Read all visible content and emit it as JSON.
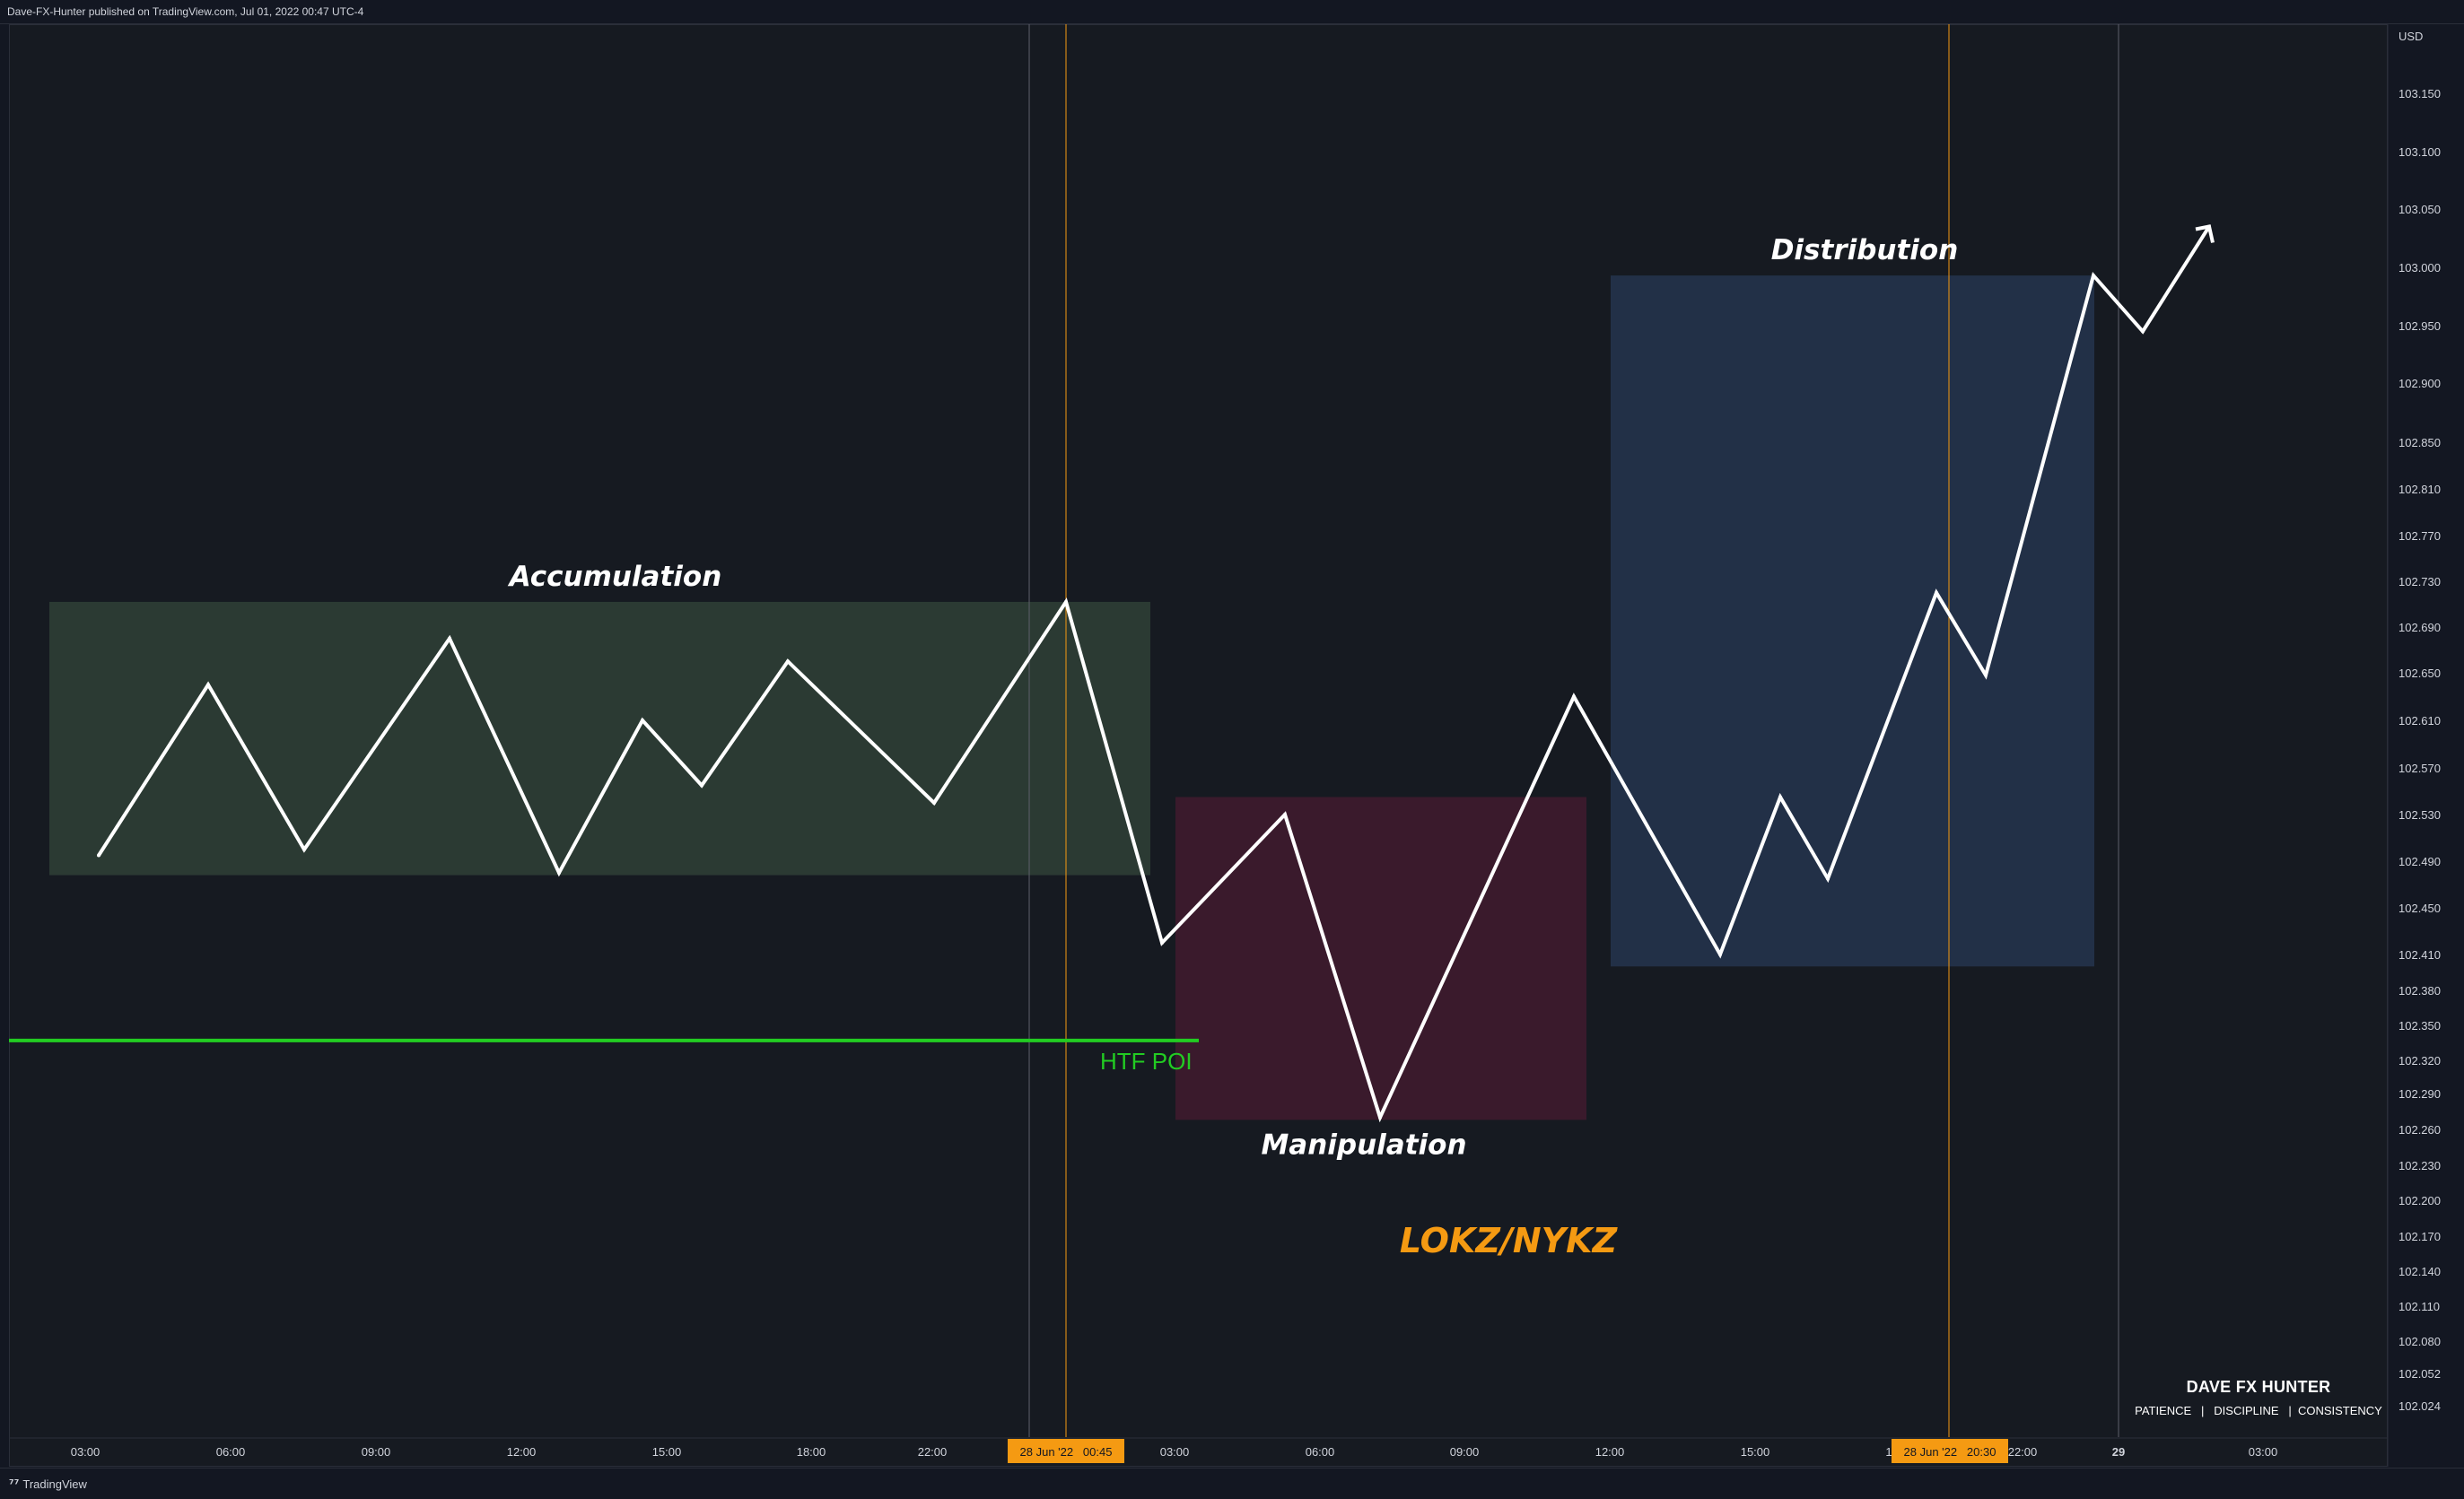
{
  "header": {
    "publisher": "Dave-FX-Hunter published on TradingView.com, Jul 01, 2022 00:47 UTC-4"
  },
  "footer": {
    "logo_text": "TradingView"
  },
  "branding": {
    "name": "DAVE FX HUNTER",
    "tagline": "PATIENCE   |   DISCIPLINE   |  CONSISTENCY"
  },
  "colors": {
    "background": "#161a21",
    "accumulation_zone": "#2b3a33",
    "manipulation_zone": "#3a1a2c",
    "distribution_zone": "#223047",
    "price_line": "#ffffff",
    "poi_line": "#22cc22",
    "session_label": "#f59a12",
    "grid_line": "#5d606b",
    "session_line": "#f59a12"
  },
  "chart_data": {
    "type": "line",
    "currency_label": "USD",
    "y_tick_labels": [
      "103.150",
      "103.100",
      "103.050",
      "103.000",
      "102.950",
      "102.900",
      "102.850",
      "102.810",
      "102.770",
      "102.730",
      "102.690",
      "102.650",
      "102.610",
      "102.570",
      "102.530",
      "102.490",
      "102.450",
      "102.410",
      "102.380",
      "102.350",
      "102.320",
      "102.290",
      "102.260",
      "102.230",
      "102.200",
      "102.170",
      "102.140",
      "102.110",
      "102.080",
      "102.052",
      "102.024"
    ],
    "x_tick_labels": [
      "03:00",
      "06:00",
      "09:00",
      "12:00",
      "15:00",
      "18:00",
      "22:00",
      "03:00",
      "06:00",
      "09:00",
      "12:00",
      "15:00",
      "1",
      "22:00",
      "29",
      "03:00"
    ],
    "x_time_badges": [
      "28 Jun '22   00:45",
      "28 Jun '22   20:30"
    ],
    "series": [
      {
        "values": [
          102.495,
          102.64,
          102.5,
          102.68,
          102.48,
          102.61,
          102.555,
          102.66,
          102.54,
          102.712,
          102.42,
          102.53,
          102.27,
          102.63,
          102.41,
          102.545,
          102.475,
          102.72,
          102.648,
          102.993,
          102.945,
          103.035
        ]
      }
    ],
    "zones": [
      {
        "label": "Accumulation",
        "y_range": [
          102.478,
          102.712
        ]
      },
      {
        "label": "Manipulation",
        "y_range": [
          102.268,
          102.545
        ]
      },
      {
        "label": "Distribution",
        "y_range": [
          102.4,
          102.993
        ]
      }
    ],
    "annotations": [
      {
        "label": "HTF POI",
        "y": 102.337
      },
      {
        "label": "LOKZ/NYKZ"
      }
    ]
  }
}
